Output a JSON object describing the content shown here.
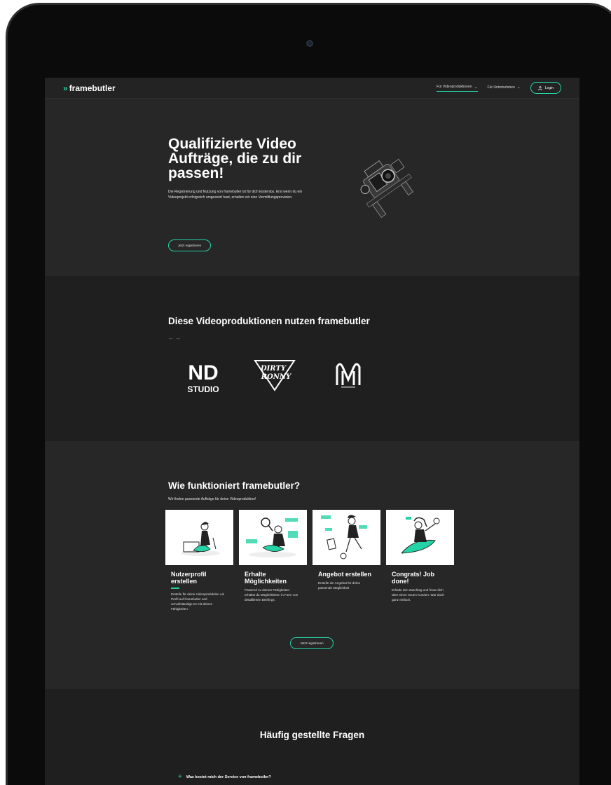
{
  "nav": {
    "logo": "framebutler",
    "items": [
      {
        "label": "Für Videoproduktionen",
        "active": true
      },
      {
        "label": "Für Unternehmen",
        "active": false
      }
    ],
    "login": "Login"
  },
  "hero": {
    "title": "Qualifizierte Video Aufträge, die zu dir passen!",
    "text": "Die Registrierung und Nutzung von framebutler ist für dich kostenlos. Erst wenn du ein Videoprojekt erfolgreich umgesetzt hast, erhalten wir eine Vermittlungsprovision.",
    "button": "Jetzt registrieren"
  },
  "partners": {
    "title": "Diese Videoproduktionen nutzen framebutler",
    "arrows": "←→",
    "logos": [
      {
        "name": "ND STUDIO",
        "line1": "ND",
        "line2": "STUDIO"
      },
      {
        "name": "DIRTY RONNY",
        "line1": "DIRTY",
        "line2": "RONNY"
      },
      {
        "name": "MW",
        "line1": "MW"
      }
    ]
  },
  "how": {
    "title": "Wie funktioniert framebutler?",
    "subtitle": "Wir finden passende Aufträge für deine Videoproduktion!",
    "steps": [
      {
        "title": "Nutzerprofil erstellen",
        "text": "Erstelle für deine Videoproduktion ein Profil auf framebutler und vervollständige es mit deinen Fähigkeiten."
      },
      {
        "title": "Erhalte Möglichkeiten",
        "text": "Passend zu deinen Fähigkeiten erhältst du Möglichkeiten in Form von detaillierten Briefings."
      },
      {
        "title": "Angebot erstellen",
        "text": "Erstelle ein Angebot für deine passende Möglichkeit"
      },
      {
        "title": "Congrats! Job done!",
        "text": "Erhalte den Zuschlag und freue dich über einen neuen Kunden. War doch ganz einfach."
      }
    ],
    "button": "Jetzt registrieren"
  },
  "faq": {
    "title": "Häufig gestellte Fragen",
    "questions": [
      "Was kostet mich der Service von framebutler?"
    ]
  },
  "colors": {
    "accent": "#25d3a6",
    "background": "#272727",
    "band": "#1f1f1f"
  }
}
